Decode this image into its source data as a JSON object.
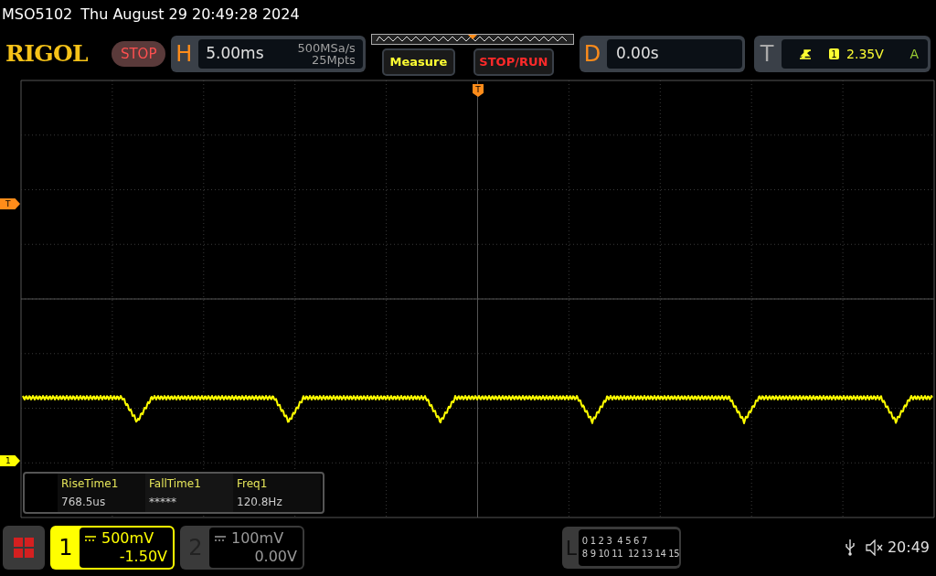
{
  "status_line": {
    "model": "MSO5102",
    "datetime": "Thu August 29 20:49:28 2024"
  },
  "header": {
    "logo": "RIGOL",
    "run_state": "STOP",
    "horizontal": {
      "label": "H",
      "timebase": "5.00ms",
      "sample_rate": "500MSa/s",
      "memory_depth": "25Mpts"
    },
    "buttons": [
      "Measure",
      "STOP/RUN"
    ],
    "delay": {
      "label": "D",
      "value": "0.00s"
    },
    "trigger": {
      "label": "T",
      "source": "1",
      "level": "2.35V",
      "mode": "A"
    }
  },
  "markers": {
    "trigger_position": "T",
    "trigger_level": "T",
    "channel_1": "1"
  },
  "measurements": [
    {
      "name": "RiseTime1",
      "value": "768.5us"
    },
    {
      "name": "FallTime1",
      "value": "*****"
    },
    {
      "name": "Freq1",
      "value": "120.8Hz"
    }
  ],
  "channels": [
    {
      "number": "1",
      "scale": "500mV",
      "offset": "-1.50V",
      "selected": true
    },
    {
      "number": "2",
      "scale": "100mV",
      "offset": "0.00V",
      "selected": false
    }
  ],
  "logic": {
    "label": "L",
    "rows": [
      [
        [
          "0",
          "1",
          "2",
          "3"
        ],
        [
          "4",
          "5",
          "6",
          "7"
        ]
      ],
      [
        [
          "8",
          "9",
          "10",
          "11"
        ],
        [
          "12",
          "13",
          "14",
          "15"
        ]
      ]
    ]
  },
  "status_bar": {
    "time": "20:49"
  }
}
